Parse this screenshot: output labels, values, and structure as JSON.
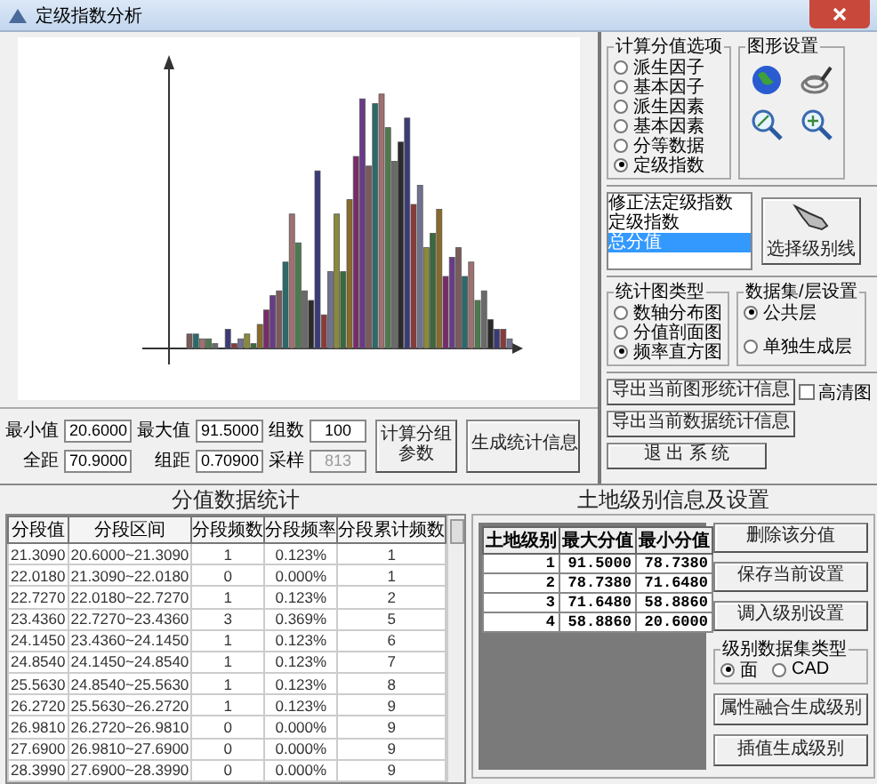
{
  "window": {
    "title": "定级指数分析"
  },
  "params": [
    {
      "label": "最小值",
      "value": "20.6000",
      "disabled": false
    },
    {
      "label": "最大值",
      "value": "91.5000",
      "disabled": false
    },
    {
      "label": "组数",
      "value": "100",
      "disabled": false
    },
    {
      "label": "全距",
      "value": "70.9000",
      "disabled": false
    },
    {
      "label": "组距",
      "value": "0.70900",
      "disabled": false
    },
    {
      "label": "采样",
      "value": "813",
      "disabled": true
    }
  ],
  "param_buttons": [
    "计算分组参数",
    "生成统计信息"
  ],
  "score_options": {
    "title": "计算分值选项",
    "options": [
      {
        "label": "派生因子",
        "selected": false
      },
      {
        "label": "基本因子",
        "selected": false
      },
      {
        "label": "派生因素",
        "selected": false
      },
      {
        "label": "基本因素",
        "selected": false
      },
      {
        "label": "分等数据",
        "selected": false
      },
      {
        "label": "定级指数",
        "selected": true
      }
    ]
  },
  "graphics_settings": {
    "title": "图形设置"
  },
  "layer_list": {
    "items": [
      {
        "label": "修正法定级指数",
        "selected": false
      },
      {
        "label": "定级指数",
        "selected": false
      },
      {
        "label": "总分值",
        "selected": true
      }
    ]
  },
  "select_level_button": "选择级别线",
  "chart_type": {
    "title": "统计图类型",
    "options": [
      {
        "label": "数轴分布图",
        "selected": false
      },
      {
        "label": "分值剖面图",
        "selected": false
      },
      {
        "label": "频率直方图",
        "selected": true
      }
    ]
  },
  "dataset": {
    "title": "数据集/层设置",
    "options": [
      {
        "label": "公共层",
        "selected": true
      },
      {
        "label": "单独生成层",
        "selected": false
      }
    ]
  },
  "export_buttons": [
    "导出当前图形统计信息",
    "导出当前数据统计信息",
    "退 出 系 统"
  ],
  "hd_checkbox": {
    "label": "高清图",
    "checked": false
  },
  "stats": {
    "title": "分值数据统计",
    "columns": [
      "分段值",
      "分段区间",
      "分段频数",
      "分段频率",
      "分段累计频数"
    ],
    "rows": [
      [
        "21.3090",
        "20.6000~21.3090",
        "1",
        "0.123%",
        "1"
      ],
      [
        "22.0180",
        "21.3090~22.0180",
        "0",
        "0.000%",
        "1"
      ],
      [
        "22.7270",
        "22.0180~22.7270",
        "1",
        "0.123%",
        "2"
      ],
      [
        "23.4360",
        "22.7270~23.4360",
        "3",
        "0.369%",
        "5"
      ],
      [
        "24.1450",
        "23.4360~24.1450",
        "1",
        "0.123%",
        "6"
      ],
      [
        "24.8540",
        "24.1450~24.8540",
        "1",
        "0.123%",
        "7"
      ],
      [
        "25.5630",
        "24.8540~25.5630",
        "1",
        "0.123%",
        "8"
      ],
      [
        "26.2720",
        "25.5630~26.2720",
        "1",
        "0.123%",
        "9"
      ],
      [
        "26.9810",
        "26.2720~26.9810",
        "0",
        "0.000%",
        "9"
      ],
      [
        "27.6900",
        "26.9810~27.6900",
        "0",
        "0.000%",
        "9"
      ],
      [
        "28.3990",
        "27.6900~28.3990",
        "0",
        "0.000%",
        "9"
      ]
    ]
  },
  "levels": {
    "title": "土地级别信息及设置",
    "columns": [
      "土地级别",
      "最大分值",
      "最小分值"
    ],
    "rows": [
      [
        "1",
        "91.5000",
        "78.7380"
      ],
      [
        "2",
        "78.7380",
        "71.6480"
      ],
      [
        "3",
        "71.6480",
        "58.8860"
      ],
      [
        "4",
        "58.8860",
        "20.6000"
      ]
    ],
    "buttons": [
      "删除该分值",
      "保存当前设置",
      "调入级别设置"
    ],
    "type_group": {
      "title": "级别数据集类型",
      "options": [
        {
          "label": "面",
          "selected": true
        },
        {
          "label": "CAD",
          "selected": false
        }
      ]
    },
    "more_buttons": [
      "属性融合生成级别",
      "插值生成级别"
    ]
  }
}
